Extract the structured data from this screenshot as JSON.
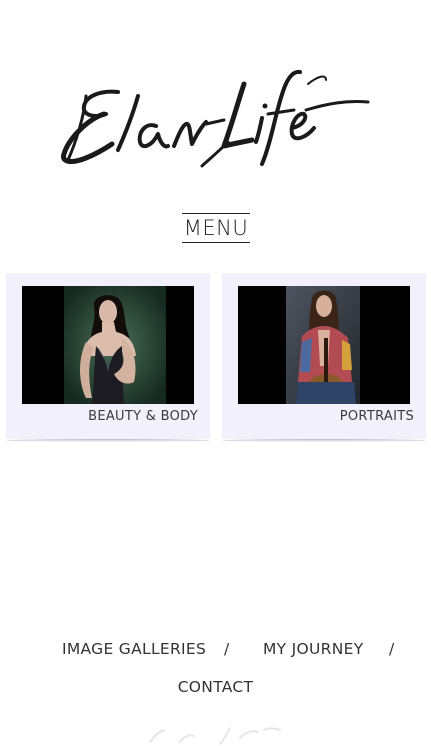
{
  "brand": {
    "logo_text": "Elan-Life"
  },
  "menu": {
    "label": "MENU"
  },
  "galleries": [
    {
      "label": "BEAUTY & BODY"
    },
    {
      "label": "PORTRAITS"
    }
  ],
  "footer": {
    "links": [
      "IMAGE GALLERIES",
      "MY JOURNEY",
      "CONTACT"
    ],
    "separator": "/"
  },
  "colors": {
    "card_bg": "#f1f0fb",
    "text": "#333333"
  }
}
